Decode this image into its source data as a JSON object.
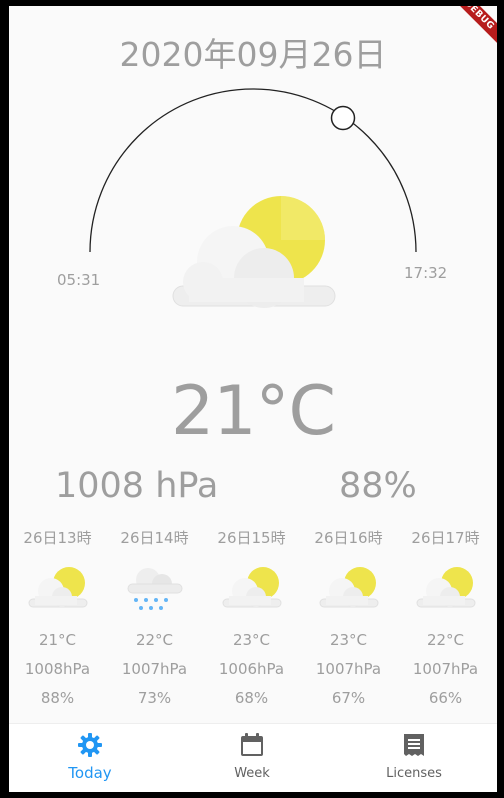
{
  "app": {
    "debug_label": "DEBUG",
    "date": "2020年09月26日",
    "sunrise": "05:31",
    "sunset": "17:32",
    "current": {
      "temperature": "21°C",
      "pressure": "1008 hPa",
      "humidity": "88%",
      "icon": "partly-cloudy-icon"
    },
    "hourly": [
      {
        "time": "26日13時",
        "icon": "partly-cloudy-icon",
        "temp": "21°C",
        "pressure": "1008hPa",
        "humidity": "88%"
      },
      {
        "time": "26日14時",
        "icon": "rain-icon",
        "temp": "22°C",
        "pressure": "1007hPa",
        "humidity": "73%"
      },
      {
        "time": "26日15時",
        "icon": "partly-cloudy-icon",
        "temp": "23°C",
        "pressure": "1006hPa",
        "humidity": "68%"
      },
      {
        "time": "26日16時",
        "icon": "partly-cloudy-icon",
        "temp": "23°C",
        "pressure": "1007hPa",
        "humidity": "67%"
      },
      {
        "time": "26日17時",
        "icon": "partly-cloudy-icon",
        "temp": "22°C",
        "pressure": "1007hPa",
        "humidity": "66%"
      }
    ],
    "nav": [
      {
        "label": "Today",
        "icon": "gear-sun-icon",
        "active": true
      },
      {
        "label": "Week",
        "icon": "calendar-icon",
        "active": false
      },
      {
        "label": "Licenses",
        "icon": "license-icon",
        "active": false
      }
    ],
    "colors": {
      "accent": "#2196f3",
      "text": "#9e9e9e",
      "sun": "#f0e44a"
    }
  }
}
